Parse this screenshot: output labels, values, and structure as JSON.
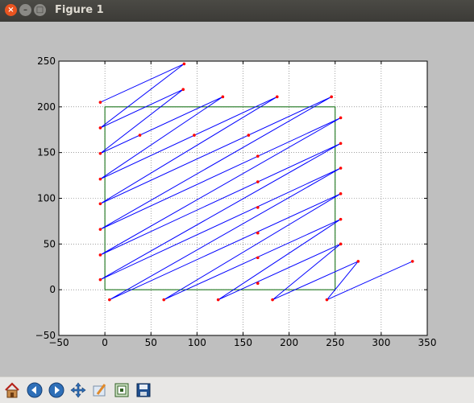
{
  "window": {
    "title": "Figure 1"
  },
  "toolbar": {
    "items": [
      {
        "name": "home-icon"
      },
      {
        "name": "back-arrow-icon"
      },
      {
        "name": "forward-arrow-icon"
      },
      {
        "name": "pan-icon"
      },
      {
        "name": "zoom-icon"
      },
      {
        "name": "subplots-icon"
      },
      {
        "name": "save-icon"
      }
    ]
  },
  "chart_data": {
    "type": "line",
    "xlim": [
      -50,
      350
    ],
    "ylim": [
      -50,
      250
    ],
    "xticks": [
      -50,
      0,
      50,
      100,
      150,
      200,
      250,
      300,
      350
    ],
    "yticks": [
      -50,
      0,
      50,
      100,
      150,
      200,
      250
    ],
    "xtick_labels": [
      "−50",
      "0",
      "50",
      "100",
      "150",
      "200",
      "250",
      "300",
      "350"
    ],
    "ytick_labels": [
      "−50",
      "0",
      "50",
      "100",
      "150",
      "200",
      "250"
    ],
    "grid": true,
    "series": [
      {
        "color": "#0000ff",
        "marker_color": "#ff0000",
        "points": [
          [
            -5,
            205
          ],
          [
            86,
            247
          ],
          [
            -5,
            177
          ],
          [
            85,
            219
          ],
          [
            -5,
            149
          ],
          [
            128,
            211
          ],
          [
            -5,
            121
          ],
          [
            187,
            211
          ],
          [
            -5,
            94
          ],
          [
            246,
            211
          ],
          [
            -5,
            66
          ],
          [
            256,
            188
          ],
          [
            -5,
            38
          ],
          [
            256,
            160
          ],
          [
            -5,
            11
          ],
          [
            256,
            133
          ],
          [
            5,
            -11
          ],
          [
            256,
            105
          ],
          [
            64,
            -11
          ],
          [
            256,
            77
          ],
          [
            123,
            -11
          ],
          [
            256,
            50
          ],
          [
            182,
            -11
          ],
          [
            275,
            31
          ],
          [
            241,
            -11
          ],
          [
            334,
            31
          ]
        ]
      }
    ],
    "extra_points": [
      [
        38,
        169
      ],
      [
        97,
        169
      ],
      [
        156,
        169
      ],
      [
        166,
        146
      ],
      [
        166,
        118
      ],
      [
        166,
        90
      ],
      [
        166,
        62
      ],
      [
        166,
        35
      ],
      [
        166,
        7
      ]
    ],
    "box": {
      "color": "#006400",
      "x": [
        0,
        250
      ],
      "y": [
        0,
        200
      ]
    }
  },
  "colors": {
    "line": "#0000ff",
    "marker": "#ff0000",
    "box": "#006400",
    "axes_bg": "#ffffff",
    "figure_bg": "#bfbfbf"
  }
}
